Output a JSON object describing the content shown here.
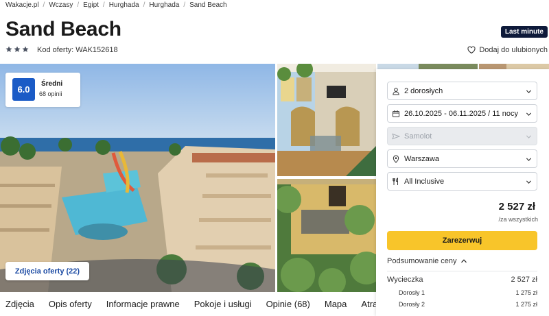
{
  "breadcrumb": [
    "Wakacje.pl",
    "Wczasy",
    "Egipt",
    "Hurghada",
    "Hurghada",
    "Sand Beach"
  ],
  "hotel": {
    "name": "Sand Beach",
    "stars": 3,
    "offer_code": "Kod oferty: WAK152618",
    "last_minute_badge": "Last minute",
    "favorite_label": "Dodaj do ulubionych"
  },
  "rating": {
    "score": "6.0",
    "label": "Średni",
    "count": "68 opinii"
  },
  "photos_button": "Zdjęcia oferty (22)",
  "booking": {
    "travelers": "2 dorosłych",
    "dates": "26.10.2025 - 06.11.2025 / 11 nocy",
    "transport": "Samolot",
    "departure": "Warszawa",
    "board": "All Inclusive",
    "price": "2 527 zł",
    "price_note": "/za wszystkich",
    "book_button": "Zarezerwuj",
    "summary_label": "Podsumowanie ceny",
    "lines": [
      {
        "label": "Wycieczka",
        "value": "2 527 zł"
      },
      {
        "label": "Dorosły 1",
        "value": "1 275 zł"
      },
      {
        "label": "Dorosły 2",
        "value": "1 275 zł"
      }
    ]
  },
  "tabs": [
    "Zdjęcia",
    "Opis oferty",
    "Informacje prawne",
    "Pokoje i usługi",
    "Opinie (68)",
    "Mapa",
    "Atrakcje"
  ],
  "colors": {
    "accent_blue": "#1b5bc6",
    "book_yellow": "#f8c52a",
    "badge_navy": "#0e1a3a"
  },
  "icons": [
    "star-icon",
    "heart-icon",
    "person-icon",
    "calendar-icon",
    "plane-icon",
    "location-pin-icon",
    "cutlery-icon",
    "chevron-down-icon",
    "chevron-up-icon"
  ]
}
